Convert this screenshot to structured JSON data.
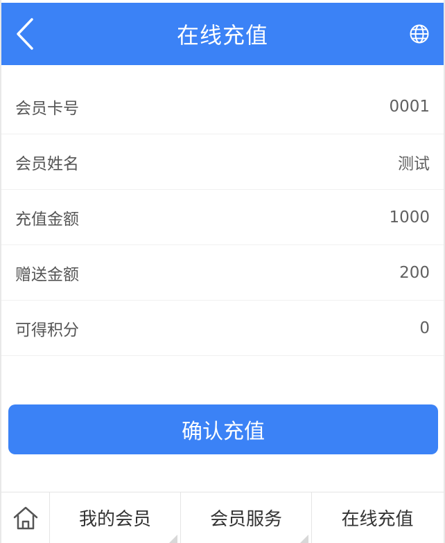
{
  "header": {
    "title": "在线充值",
    "back_icon": "chevron-left-icon",
    "globe_icon": "globe-icon",
    "background": "#3b82f6"
  },
  "fields": [
    {
      "label": "会员卡号",
      "value": "0001"
    },
    {
      "label": "会员姓名",
      "value": "测试"
    },
    {
      "label": "充值金额",
      "value": "1000"
    },
    {
      "label": "赠送金额",
      "value": "200"
    },
    {
      "label": "可得积分",
      "value": "0"
    }
  ],
  "confirm_button": {
    "label": "确认充值",
    "color": "#3b82f6"
  },
  "tabbar": {
    "home_icon": "home-icon",
    "tabs": [
      {
        "label": "我的会员"
      },
      {
        "label": "会员服务"
      },
      {
        "label": "在线充值"
      }
    ]
  }
}
